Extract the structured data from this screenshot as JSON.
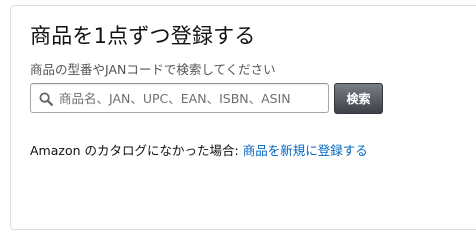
{
  "title": "商品を1点ずつ登録する",
  "subtitle": "商品の型番やJANコードで検索してください",
  "search": {
    "placeholder": "商品名、JAN、UPC、EAN、ISBN、ASIN",
    "value": "",
    "button_label": "検索",
    "icon": "search-icon"
  },
  "catalog": {
    "prefix": "Amazon のカタログになかった場合: ",
    "link_label": "商品を新規に登録する"
  },
  "colors": {
    "link": "#0066c0",
    "button_bg": "#4a4e54",
    "title_text": "#111111"
  }
}
